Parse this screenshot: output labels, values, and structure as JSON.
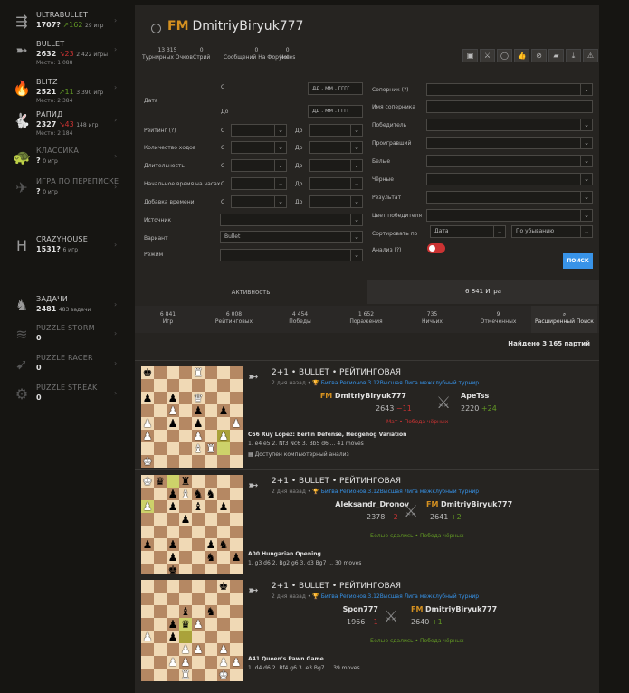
{
  "sidebar": [
    {
      "icon": "ultrabullet-icon",
      "name": "ULTRABULLET",
      "rating": "1707?",
      "trend": "up",
      "delta": "162",
      "games": "29 игр",
      "place": ""
    },
    {
      "icon": "bullet-icon",
      "name": "BULLET",
      "rating": "2632",
      "trend": "down",
      "delta": "23",
      "games": "2 422 игры",
      "place": "Место: 1 088"
    },
    {
      "icon": "blitz-icon",
      "name": "BLITZ",
      "rating": "2521",
      "trend": "up",
      "delta": "11",
      "games": "3 390 игр",
      "place": "Место: 2 384"
    },
    {
      "icon": "rapid-icon",
      "name": "РАПИД",
      "rating": "2327",
      "trend": "down",
      "delta": "43",
      "games": "148 игр",
      "place": "Место: 2 184"
    },
    {
      "icon": "classical-icon",
      "name": "КЛАССИКА",
      "rating": "?",
      "trend": "",
      "delta": "",
      "games": "0 игр",
      "place": ""
    },
    {
      "icon": "correspondence-icon",
      "name": "ИГРА ПО ПЕРЕПИСКЕ",
      "rating": "?",
      "trend": "",
      "delta": "",
      "games": "0 игр",
      "place": ""
    },
    {
      "icon": "crazyhouse-icon",
      "name": "CRAZYHOUSE",
      "rating": "1531?",
      "trend": "",
      "delta": "",
      "games": "6 игр",
      "place": ""
    },
    {
      "icon": "puzzle-icon",
      "name": "ЗАДАЧИ",
      "rating": "2481",
      "trend": "",
      "delta": "",
      "games": "483 задачи",
      "place": ""
    },
    {
      "icon": "storm-icon",
      "name": "PUZZLE STORM",
      "rating": "0",
      "trend": "",
      "delta": "",
      "games": "",
      "place": ""
    },
    {
      "icon": "racer-icon",
      "name": "PUZZLE RACER",
      "rating": "0",
      "trend": "",
      "delta": "",
      "games": "",
      "place": ""
    },
    {
      "icon": "streak-icon",
      "name": "PUZZLE STREAK",
      "rating": "0",
      "trend": "",
      "delta": "",
      "games": "",
      "place": ""
    }
  ],
  "header": {
    "title_prefix": "FM",
    "title_name": "DmitriyBiryuk777"
  },
  "stats": [
    {
      "value": "13 315",
      "label": "Турнирных Очков"
    },
    {
      "value": "0",
      "label": "Стрий"
    },
    {
      "value": "0",
      "label": "Сообщений На Форуме"
    },
    {
      "value": "0",
      "label": "Notes"
    }
  ],
  "toolbar_icons": [
    "video-icon",
    "swords-icon",
    "chat-icon",
    "thumbs-up-icon",
    "block-icon",
    "book-icon",
    "download-icon",
    "flag-icon"
  ],
  "form": {
    "date_label": "Дата",
    "date_from": "С",
    "date_to": "До",
    "date_placeholder": "дд . мм . гггг",
    "rating_label": "Рейтинг (?)",
    "moves_label": "Количество ходов",
    "duration_label": "Длительность",
    "clock_initial_label": "Начальное время на часах",
    "clock_increment_label": "Добавка времени",
    "from": "С",
    "to": "До",
    "source_label": "Источник",
    "variant_label": "Вариант",
    "variant_value": "Bullet",
    "mode_label": "Режим",
    "opponent_label": "Соперник (?)",
    "opponent_name_label": "Имя соперника",
    "winner_label": "Победитель",
    "loser_label": "Проигравший",
    "white_label": "Белые",
    "black_label": "Чёрные",
    "result_label": "Результат",
    "winner_color_label": "Цвет победителя",
    "sort_label": "Сортировать по",
    "sort_field": "Дата",
    "sort_order": "По убыванию",
    "analysis_label": "Анализ (?)",
    "search_button": "ПОИСК"
  },
  "tabs": {
    "activity": "Активность",
    "games": "6 841 Игра"
  },
  "subtabs": [
    {
      "value": "6 841",
      "label": "Игр"
    },
    {
      "value": "6 008",
      "label": "Рейтинговых"
    },
    {
      "value": "4 454",
      "label": "Победы"
    },
    {
      "value": "1 652",
      "label": "Поражения"
    },
    {
      "value": "735",
      "label": "Ничьих"
    },
    {
      "value": "9",
      "label": "Отмеченных"
    },
    {
      "value": "",
      "label": "Расширенный Поиск"
    }
  ],
  "found": "Найдено 3 165 партий",
  "games": [
    {
      "type": "2+1 • BULLET • РЕЙТИНГОВАЯ",
      "when": "2 дня назад",
      "tournament": "Битва Регионов 3.12Высшая Лига межклубный турнир",
      "white": {
        "title": "FM",
        "name": "DmitriyBiryuk777",
        "rating": "2643",
        "diff": "−11",
        "diff_trend": "down"
      },
      "black": {
        "title": "",
        "name": "ApeTss",
        "rating": "2220",
        "diff": "+24",
        "diff_trend": "up"
      },
      "result": "Мат • Победа чёрных",
      "result_color": "#cc3333",
      "opening": "C66 Ruy Lopez: Berlin Defense, Hedgehog Variation",
      "moves": "1. e4 e5 2. Nf3 Nc6 3. Bb5 d6 ... 41 moves",
      "analysis": "Доступен компьютерный анализ",
      "board": [
        "k...R...",
        "........",
        "p.p.Q...",
        "..P.p.p.",
        "P.p.p..P",
        "P...P.P.",
        "....BR..",
        "K......."
      ],
      "highlight": [
        46,
        54
      ]
    },
    {
      "type": "2+1 • BULLET • РЕЙТИНГОВАЯ",
      "when": "2 дня назад",
      "tournament": "Битва Регионов 3.12Высшая Лига межклубный турнир",
      "white": {
        "title": "",
        "name": "Aleksandr_Dronov",
        "rating": "2378",
        "diff": "−2",
        "diff_trend": "down"
      },
      "black": {
        "title": "FM",
        "name": "DmitriyBiryuk777",
        "rating": "2641",
        "diff": "+2",
        "diff_trend": "up"
      },
      "result": "Белые сдались • Победа чёрных",
      "result_color": "#629924",
      "opening": "A00 Hungarian Opening",
      "moves": "1. g3 d6 2. Bg2 g6 3. d3 Bg7 ... 30 moves",
      "analysis": "",
      "board": [
        "Kq.r....",
        "..pBnn..",
        "P.p.b.p.",
        "...p....",
        "........",
        "p.p..pn.",
        "..p..n.p",
        "..k....."
      ],
      "highlight": [
        2,
        16
      ]
    },
    {
      "type": "2+1 • BULLET • РЕЙТИНГОВАЯ",
      "when": "2 дня назад",
      "tournament": "Битва Регионов 3.12Высшая Лига межклубный турнир",
      "white": {
        "title": "",
        "name": "Spon777",
        "rating": "1966",
        "diff": "−1",
        "diff_trend": "down"
      },
      "black": {
        "title": "FM",
        "name": "DmitriyBiryuk777",
        "rating": "2640",
        "diff": "+1",
        "diff_trend": "up"
      },
      "result": "Белые сдались • Победа чёрных",
      "result_color": "#629924",
      "opening": "A41 Queen's Pawn Game",
      "moves": "1. d4 d6 2. Bf4 g6 3. e3 Bg7 ... 39 moves",
      "analysis": "",
      "board": [
        "......k.",
        "........",
        "...b.n..",
        "..pqP...",
        "P.p.....",
        "...PP.P.",
        "..PP..PP",
        "...R..K."
      ],
      "highlight": [
        27,
        35
      ]
    }
  ]
}
